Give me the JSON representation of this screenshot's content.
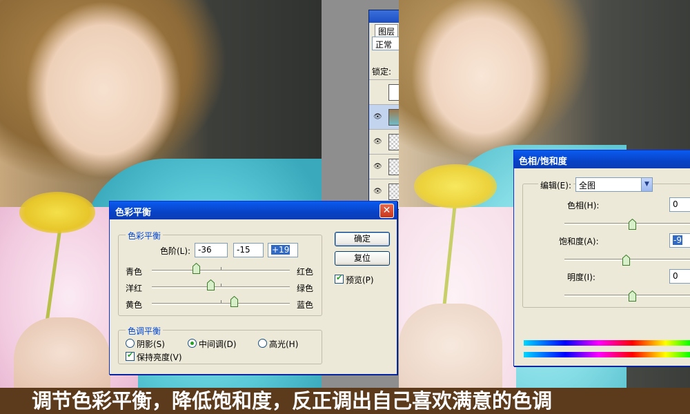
{
  "layers_panel": {
    "tab_label": "图层",
    "blend_mode": "正常",
    "lock_label": "锁定:"
  },
  "color_balance": {
    "title": "色彩平衡",
    "group_title": "色彩平衡",
    "levels_label": "色阶(L):",
    "level_values": [
      "-36",
      "-15",
      "+19"
    ],
    "sliders": [
      {
        "left": "青色",
        "right": "红色",
        "value": -36
      },
      {
        "left": "洋红",
        "right": "绿色",
        "value": -15
      },
      {
        "left": "黄色",
        "right": "蓝色",
        "value": 19
      }
    ],
    "ok_label": "确定",
    "reset_label": "复位",
    "preview_label": "预览(P)",
    "tone_group_title": "色调平衡",
    "tone_options": [
      "阴影(S)",
      "中间调(D)",
      "高光(H)"
    ],
    "tone_selected": "中间调(D)",
    "preserve_label": "保持亮度(V)",
    "preview_checked": true,
    "preserve_checked": true
  },
  "hue_saturation": {
    "title": "色相/饱和度",
    "edit_label": "编辑(E):",
    "edit_value": "全图",
    "hue_label": "色相(H):",
    "hue_value": "0",
    "saturation_label": "饱和度(A):",
    "saturation_value": "-9",
    "lightness_label": "明度(I):",
    "lightness_value": "0"
  },
  "caption": "调节色彩平衡，降低饱和度，反正调出自己喜欢满意的色调",
  "colors": {
    "xp_titlebar": "#0a5bf0",
    "dialog_bg": "#ece9d8",
    "caption_bg": "#5c3a1c"
  }
}
